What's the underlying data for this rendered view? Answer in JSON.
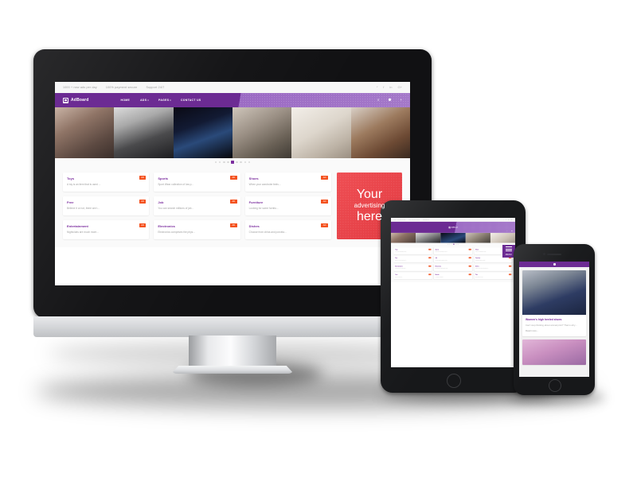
{
  "site": {
    "brand": "AdBoard",
    "topbar": {
      "items": [
        "1000 + new ads per day",
        "100% payment secure",
        "Support 24/7"
      ],
      "social": [
        {
          "name": "twitter-icon",
          "glyph": "ᵛ"
        },
        {
          "name": "facebook-icon",
          "glyph": "f"
        },
        {
          "name": "linkedin-icon",
          "glyph": "in"
        },
        {
          "name": "googleplus-icon",
          "glyph": "G+"
        }
      ]
    },
    "nav": {
      "links": [
        {
          "label": "HOME",
          "caret": ""
        },
        {
          "label": "ADS",
          "caret": "▾"
        },
        {
          "label": "PAGES",
          "caret": "▾"
        },
        {
          "label": "CONTACT US",
          "caret": ""
        }
      ],
      "icons": [
        {
          "name": "search-icon",
          "glyph": "⌕"
        },
        {
          "name": "account-icon",
          "glyph": "⚉"
        },
        {
          "name": "add-icon",
          "glyph": "+"
        }
      ],
      "menu_label": "MENU"
    },
    "carousel": {
      "dot_count": 9,
      "active_index": 4
    },
    "cards": [
      {
        "title": "Toys",
        "desc": "A toy is an item that is used ...",
        "badge": "AD"
      },
      {
        "title": "Sports",
        "desc": "Sport Wear collection of low p...",
        "badge": "AD"
      },
      {
        "title": "Shoes",
        "desc": "When your wardrobe feels...",
        "badge": "AD"
      },
      {
        "title": "Free",
        "desc": "Believe it or not, there are t...",
        "badge": "AD"
      },
      {
        "title": "Job",
        "desc": "You can search millions of job...",
        "badge": "AD"
      },
      {
        "title": "Furniture",
        "desc": "Looking for some furnitu...",
        "badge": "AD"
      },
      {
        "title": "Entertainment",
        "desc": "Nightclubs are much more...",
        "badge": "AD"
      },
      {
        "title": "Electronics",
        "desc": "Electronics comprises the phys...",
        "badge": "AD"
      },
      {
        "title": "Dishes",
        "desc": "Choose from china and porcela...",
        "badge": "AD"
      }
    ],
    "tablet_extra_cards": [
      {
        "title": "Cars",
        "desc": "Car is a wheeled...",
        "badge": "AD"
      },
      {
        "title": "Brands",
        "desc": "A brand is a named...",
        "badge": "AD"
      },
      {
        "title": "Pets",
        "desc": "Our pets are clean...",
        "badge": "AD"
      }
    ],
    "ad_panel": {
      "line1": "Your",
      "line2": "advertising",
      "line3": "here",
      "color": "#e8434a"
    }
  },
  "phone": {
    "article": {
      "title": "Women's high heeled shoes",
      "excerpt": "Can't stop thinking about animal print? That is why...",
      "link": "Read more..."
    }
  },
  "colors": {
    "brand_purple": "#6c2b93",
    "brand_purple_light": "#a478c9",
    "badge_orange": "#f4511e",
    "ad_red": "#e8434a",
    "page_bg": "#fafafa"
  }
}
